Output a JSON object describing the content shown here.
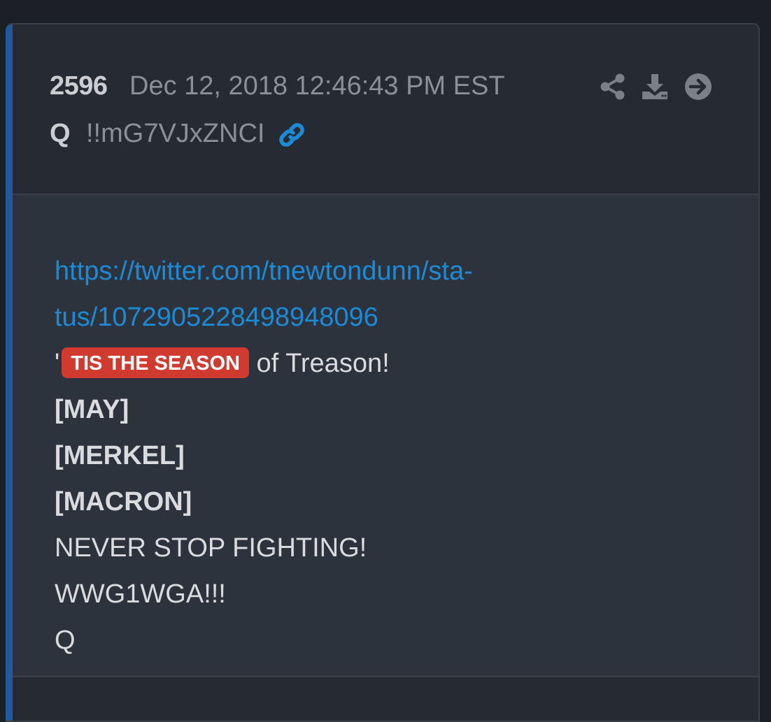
{
  "post": {
    "number": "2596",
    "date": "Dec 12, 2018 12:46:43 PM EST",
    "author": "Q",
    "tripcode": "!!mG7VJxZNCI"
  },
  "icons": {
    "link": "link-icon",
    "share": "share-icon",
    "download": "download-icon",
    "open": "arrow-circle-right-icon"
  },
  "content": {
    "url_line1": "https://twitter.com/tnewtondunn/sta-",
    "url_line2": "tus/1072905228498948096",
    "season_prefix": "'",
    "season_badge": "TIS THE SEASON",
    "season_suffix": " of Treason!",
    "line_may": "[MAY]",
    "line_merkel": "[MERKEL]",
    "line_macron": "[MACRON]",
    "line_never": "NEVER STOP FIGHTING!",
    "line_wwg": "WWG1WGA!!!",
    "line_sig": "Q"
  },
  "colors": {
    "accent": "#1f5a9c",
    "link": "#1d8ad6",
    "badge": "#d03a2f"
  }
}
